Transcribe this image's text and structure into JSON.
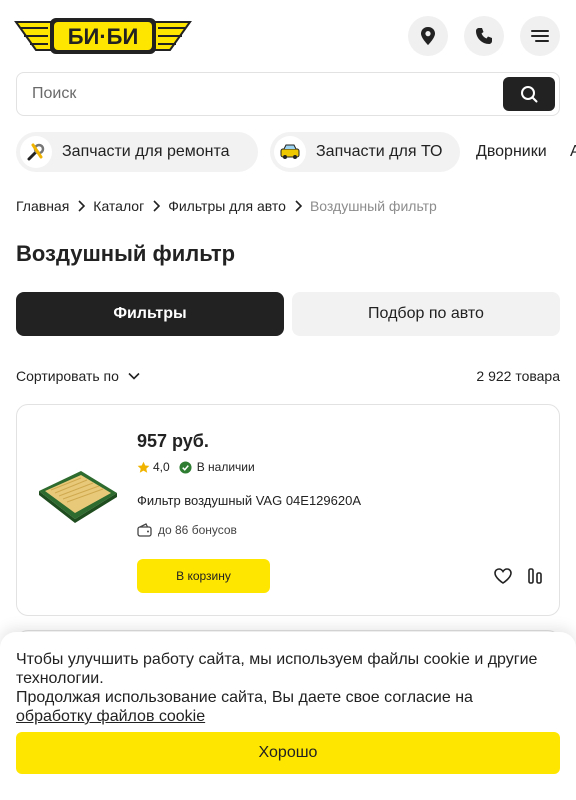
{
  "brand": {
    "logo_text": "БИ·БИ",
    "accent": "#ffe600",
    "dark": "#222222"
  },
  "header": {
    "icons": [
      "location-pin-icon",
      "phone-icon",
      "menu-icon"
    ]
  },
  "search": {
    "placeholder": "Поиск"
  },
  "categories": [
    {
      "label": "Запчасти для ремонта",
      "icon": "wrench-icon"
    },
    {
      "label": "Запчасти для ТО",
      "icon": "car-icon"
    },
    {
      "label": "Дворники"
    },
    {
      "label": "А"
    }
  ],
  "breadcrumb": [
    "Главная",
    "Каталог",
    "Фильтры для авто",
    "Воздушный фильтр"
  ],
  "page_title": "Воздушный фильтр",
  "tabs": {
    "active": "Фильтры",
    "inactive": "Подбор по авто"
  },
  "sort": {
    "label": "Сортировать по",
    "count": "2 922 товара"
  },
  "product": {
    "price": "957 руб.",
    "rating": "4,0",
    "availability": "В наличии",
    "name": "Фильтр воздушный VAG 04E129620A",
    "bonus": "до 86 бонусов",
    "cart_label": "В корзину"
  },
  "cookie": {
    "line1": "Чтобы улучшить работу сайта, мы используем файлы cookie и другие технологии.",
    "line2": "Продолжая использование сайта, Вы даете свое согласие на",
    "link": "обработку файлов cookie",
    "ok_label": "Хорошо"
  }
}
